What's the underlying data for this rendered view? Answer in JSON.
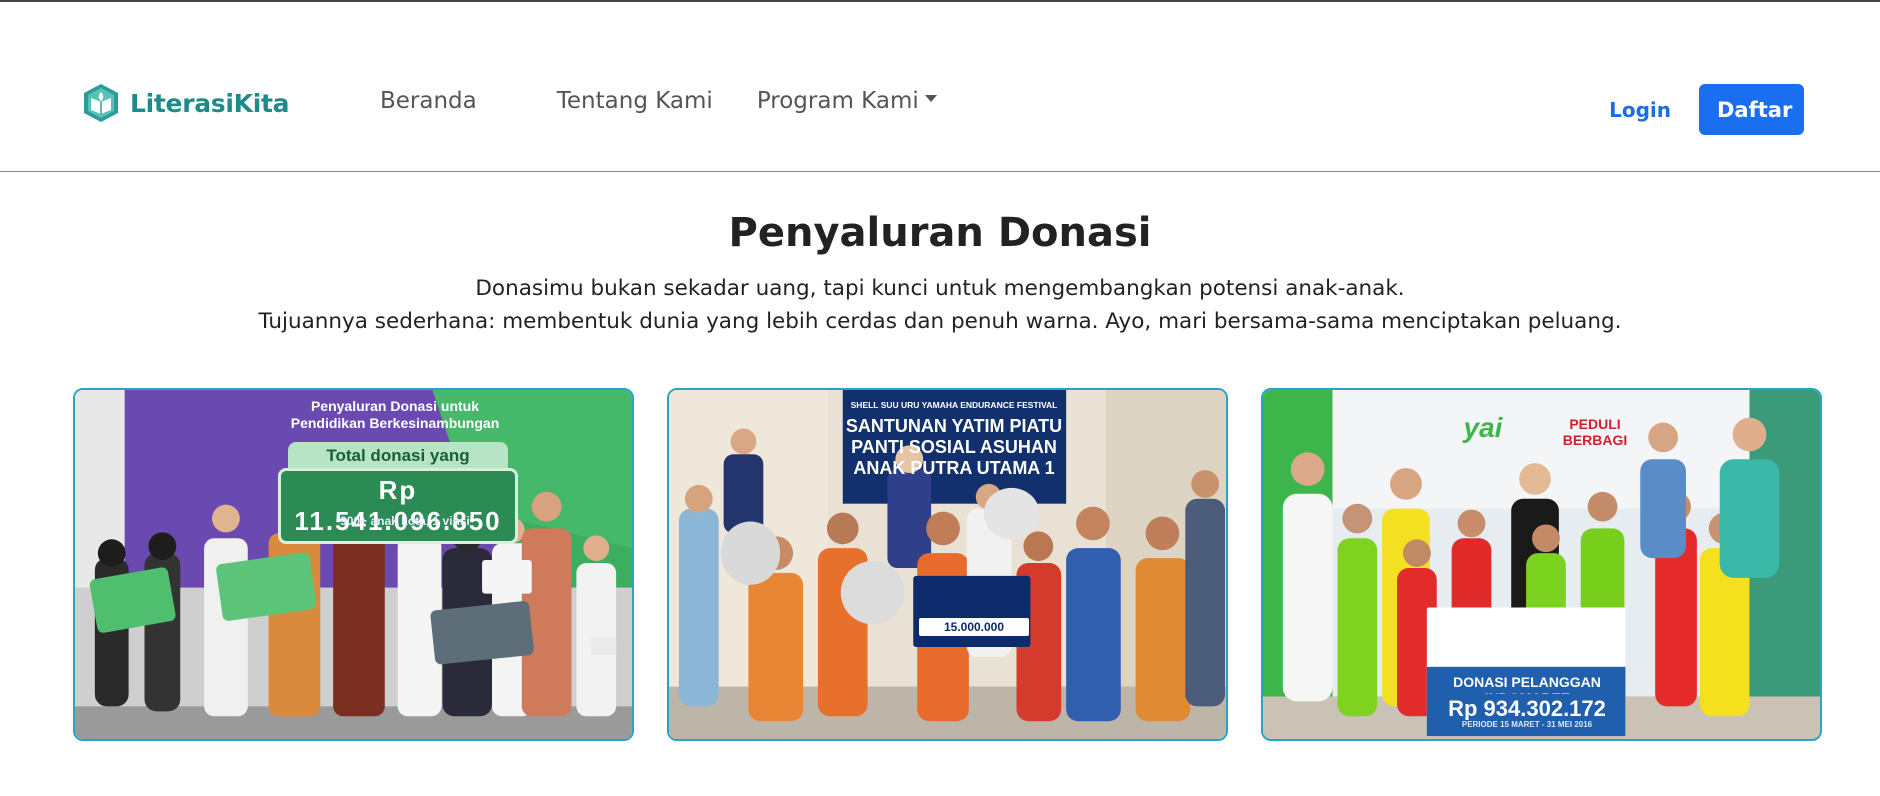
{
  "brand": {
    "name": "LiterasiKita",
    "icon": "book-leaf-logo-icon",
    "color": "#1f8a8a"
  },
  "nav": {
    "items": [
      {
        "label": "Beranda"
      },
      {
        "label": "Tentang Kami"
      },
      {
        "label": "Program Kami",
        "has_dropdown": true
      }
    ]
  },
  "auth": {
    "login_label": "Login",
    "register_label": "Daftar",
    "accent": "#1a6ff0"
  },
  "section": {
    "title": "Penyaluran Donasi",
    "description_line1": "Donasimu bukan sekadar uang, tapi kunci untuk mengembangkan potensi anak-anak.",
    "description_line2": "Tujuannya sederhana: membentuk dunia yang lebih cerdas dan penuh warna. Ayo, mari bersama-sama menciptakan peluang."
  },
  "cards": [
    {
      "photo_text": {
        "title": "Penyaluran Donasi untuk Pendidikan Berkesinambungan",
        "total_label": "Total donasi yang terkumpul",
        "amount": "Rp 11.541.096.850",
        "sub": "900+ anak  kota, 1  vinsi"
      }
    },
    {
      "photo_text": {
        "banner_top": "SHELL SUU URU YAMAHA ENDURANCE FESTIVAL",
        "banner": "SANTUNAN YATIM PIATU PANTI SOSIAL ASUHAN ANAK PUTRA UTAMA 1",
        "amount": "15.000.000"
      }
    },
    {
      "photo_text": {
        "logo": "yai",
        "partner": "PEDULI BERBAGI",
        "board_title": "DONASI PELANGGAN INDOMARET",
        "board_amount": "Rp 934.302.172",
        "board_period": "PERIODE 15 MARET - 31 MEI 2016"
      }
    }
  ],
  "colors": {
    "card_border": "#2aa3c8",
    "nav_divider": "#3d9bd6"
  }
}
